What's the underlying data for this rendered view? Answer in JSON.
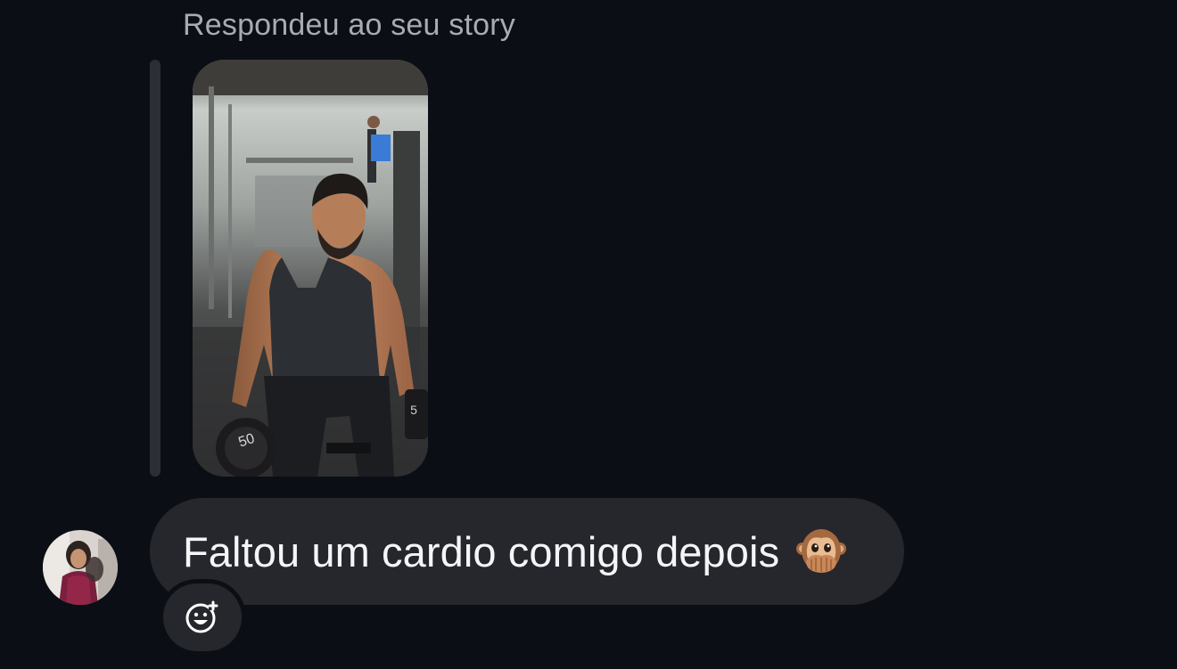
{
  "reply": {
    "header": "Respondeu ao seu story"
  },
  "message": {
    "text": "Faltou um cardio comigo depois",
    "emoji": "speak-no-evil-monkey"
  },
  "icons": {
    "react": "add-reaction-smiley-icon"
  },
  "colors": {
    "background": "#0b0e15",
    "bubble": "#25272d",
    "header_text": "#a8abb2",
    "message_text": "#f5f5f7"
  }
}
